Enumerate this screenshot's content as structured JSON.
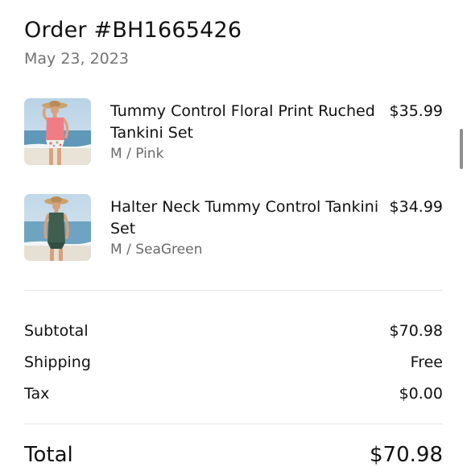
{
  "order": {
    "title": "Order #BH1665426",
    "date": "May 23, 2023"
  },
  "items": [
    {
      "name": "Tummy Control Floral Print Ruched Tankini Set",
      "variant": "M / Pink",
      "price": "$35.99",
      "image": "model-pink-tankini-photo"
    },
    {
      "name": "Halter Neck Tummy Control Tankini Set",
      "variant": "M / SeaGreen",
      "price": "$34.99",
      "image": "model-seagreen-tankini-photo"
    }
  ],
  "summary": {
    "subtotal_label": "Subtotal",
    "subtotal_value": "$70.98",
    "shipping_label": "Shipping",
    "shipping_value": "Free",
    "tax_label": "Tax",
    "tax_value": "$0.00",
    "total_label": "Total",
    "total_value": "$70.98"
  },
  "colors": {
    "text": "#111111",
    "muted": "#737373",
    "divider": "#e4e4e4"
  }
}
